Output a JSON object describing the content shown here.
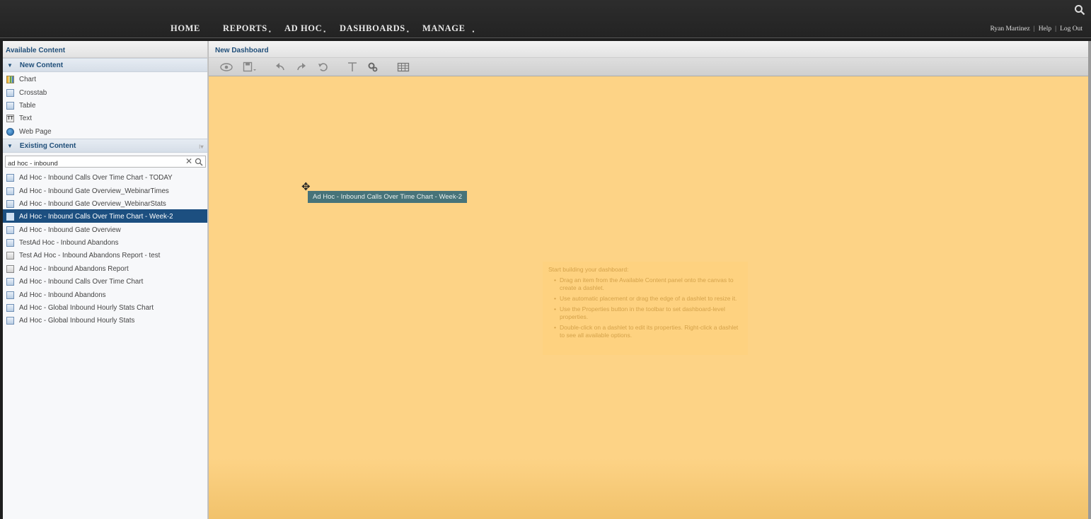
{
  "nav": {
    "items": [
      {
        "label": "HOME",
        "has_menu": false
      },
      {
        "label": "REPORTS",
        "has_menu": true
      },
      {
        "label": "AD HOC",
        "has_menu": true
      },
      {
        "label": "DASHBOARDS",
        "has_menu": true
      },
      {
        "label": "MANAGE",
        "has_menu": true
      }
    ],
    "user": "Ryan Martinez",
    "help": "Help",
    "logout": "Log Out",
    "search_icon": "search-icon"
  },
  "left": {
    "title": "Available Content",
    "new_content": {
      "heading": "New Content",
      "items": [
        {
          "label": "Chart",
          "icon": "chart-icon"
        },
        {
          "label": "Crosstab",
          "icon": "crosstab-icon"
        },
        {
          "label": "Table",
          "icon": "table-icon"
        },
        {
          "label": "Text",
          "icon": "text-icon"
        },
        {
          "label": "Web Page",
          "icon": "web-page-icon"
        }
      ]
    },
    "existing_content": {
      "heading": "Existing Content",
      "search_value": "ad hoc - inbound",
      "items": [
        {
          "label": "Ad Hoc - Inbound Calls Over Time Chart - TODAY"
        },
        {
          "label": "Ad Hoc - Inbound Gate Overview_WebinarTimes"
        },
        {
          "label": "Ad Hoc - Inbound Gate Overview_WebinarStats"
        },
        {
          "label": "Ad Hoc - Inbound Calls Over Time Chart - Week-2",
          "selected": true
        },
        {
          "label": "Ad Hoc - Inbound Gate Overview"
        },
        {
          "label": "TestAd Hoc - Inbound Abandons"
        },
        {
          "label": "Test Ad Hoc - Inbound Abandons Report - test",
          "report": true
        },
        {
          "label": "Ad Hoc - Inbound Abandons Report",
          "report": true
        },
        {
          "label": "Ad Hoc - Inbound Calls Over Time Chart"
        },
        {
          "label": "Ad Hoc - Inbound Abandons"
        },
        {
          "label": "Ad Hoc - Global Inbound Hourly Stats Chart"
        },
        {
          "label": "Ad Hoc - Global Inbound Hourly Stats"
        }
      ]
    }
  },
  "main": {
    "title": "New Dashboard",
    "toolbar": [
      "preview-icon",
      "save-icon",
      "undo-icon",
      "redo-icon",
      "undo-all-icon",
      "filter-icon",
      "properties-icon",
      "grid-icon"
    ],
    "drag_label": "Ad Hoc - Inbound Calls Over Time Chart - Week-2",
    "hint": {
      "heading": "Start building your dashboard:",
      "items": [
        "Drag an item from the Available Content panel onto the canvas to create a dashlet.",
        "Use automatic placement or drag the edge of a dashlet to resize it.",
        "Use the Properties button in the toolbar to set dashboard-level properties.",
        "Double-click on a dashlet to edit its properties. Right-click a dashlet to see all available options."
      ]
    }
  },
  "colors": {
    "canvas": "#fdd386",
    "selected_row": "#1c4f80",
    "drag_item": "#3e6e79"
  }
}
